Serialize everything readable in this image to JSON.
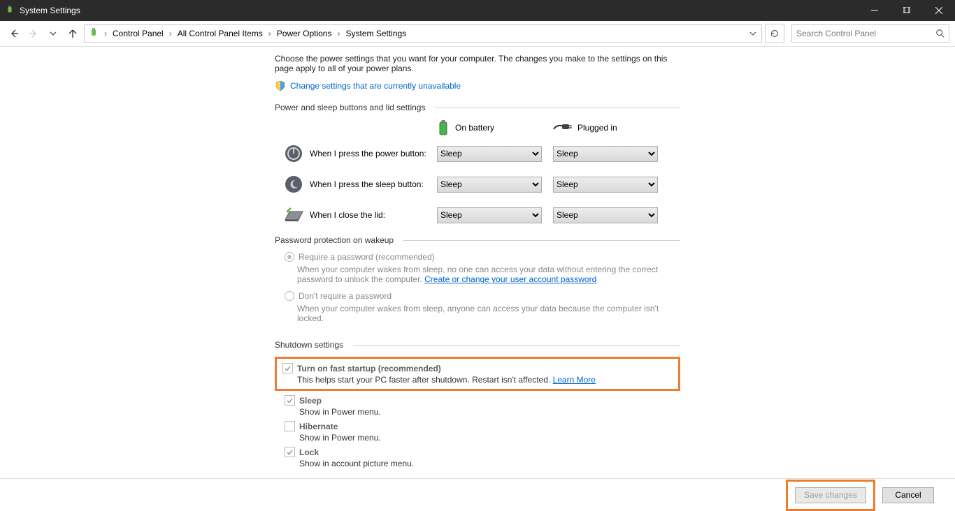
{
  "titlebar": {
    "title": "System Settings"
  },
  "breadcrumb": {
    "segments": [
      "Control Panel",
      "All Control Panel Items",
      "Power Options",
      "System Settings"
    ]
  },
  "search": {
    "placeholder": "Search Control Panel"
  },
  "intro": "Choose the power settings that you want for your computer. The changes you make to the settings on this page apply to all of your power plans.",
  "change_link": "Change settings that are currently unavailable",
  "sections": {
    "power_buttons": "Power and sleep buttons and lid settings",
    "password": "Password protection on wakeup",
    "shutdown": "Shutdown settings"
  },
  "columns": {
    "battery": "On battery",
    "plugged": "Plugged in"
  },
  "power_rows": [
    {
      "label": "When I press the power button:",
      "battery": "Sleep",
      "plugged": "Sleep"
    },
    {
      "label": "When I press the sleep button:",
      "battery": "Sleep",
      "plugged": "Sleep"
    },
    {
      "label": "When I close the lid:",
      "battery": "Sleep",
      "plugged": "Sleep"
    }
  ],
  "password": {
    "require": {
      "label": "Require a password (recommended)",
      "desc_pre": "When your computer wakes from sleep, no one can access your data without entering the correct password to unlock the computer. ",
      "link": "Create or change your user account password"
    },
    "dont": {
      "label": "Don't require a password",
      "desc": "When your computer wakes from sleep, anyone can access your data because the computer isn't locked."
    }
  },
  "shutdown": {
    "fast": {
      "label": "Turn on fast startup (recommended)",
      "desc_pre": "This helps start your PC faster after shutdown. Restart isn't affected. ",
      "link": "Learn More"
    },
    "sleep": {
      "label": "Sleep",
      "desc": "Show in Power menu."
    },
    "hibernate": {
      "label": "Hibernate",
      "desc": "Show in Power menu."
    },
    "lock": {
      "label": "Lock",
      "desc": "Show in account picture menu."
    }
  },
  "footer": {
    "save": "Save changes",
    "cancel": "Cancel"
  }
}
